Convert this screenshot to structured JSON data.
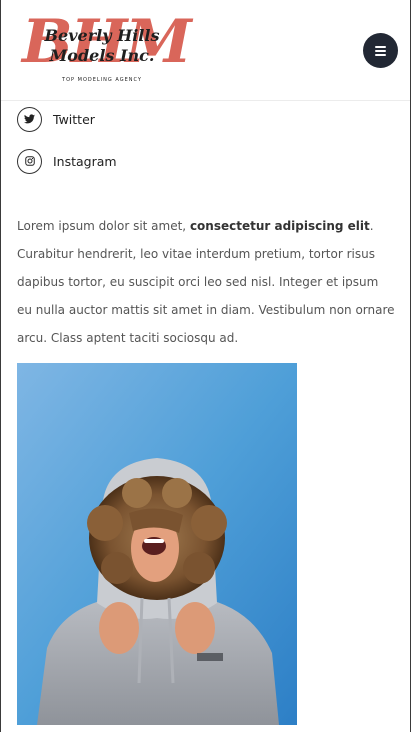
{
  "header": {
    "logo_monogram": "BHM",
    "logo_line1": "Beverly Hills",
    "logo_line2": "Models Inc.",
    "logo_tagline": "TOP MODELING AGENCY"
  },
  "social": {
    "items": [
      {
        "label": "Twitter",
        "icon": "twitter-icon"
      },
      {
        "label": "Instagram",
        "icon": "instagram-icon"
      }
    ]
  },
  "content": {
    "paragraph_part1": "Lorem ipsum dolor sit amet, ",
    "paragraph_bold": "consectetur adipiscing elit",
    "paragraph_part2": ". Curabitur hendrerit, leo vitae interdum pretium, tortor risus dapibus tortor, eu suscipit orci leo sed nisl. Integer et ipsum eu nulla auctor mattis sit amet in diam. Vestibulum non ornare arcu. Class aptent taciti sociosqu ad."
  },
  "colors": {
    "brand_accent": "#d9665a",
    "menu_button": "#222834",
    "photo_background": "#4f9fd8"
  }
}
